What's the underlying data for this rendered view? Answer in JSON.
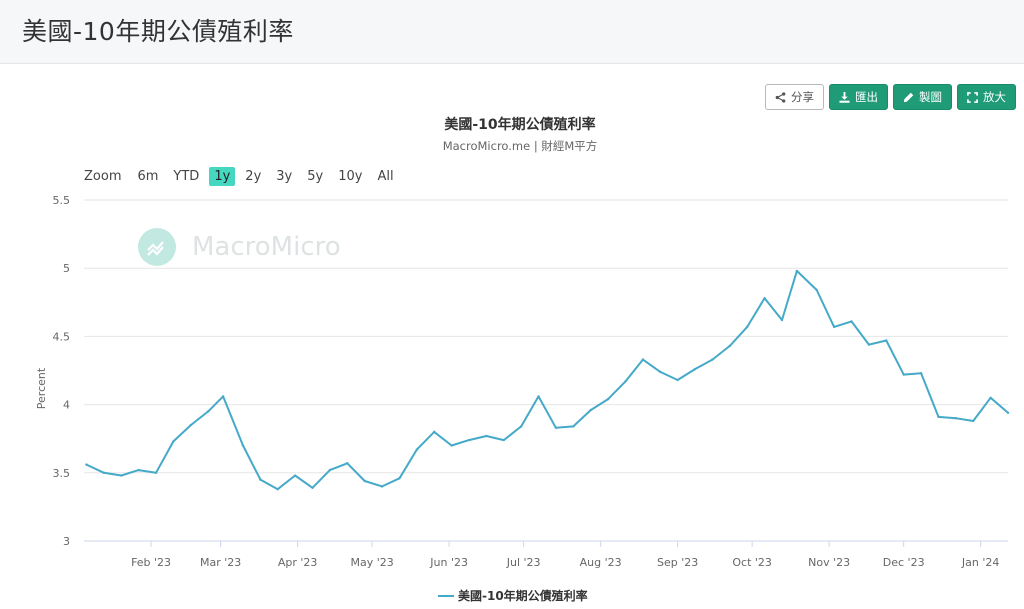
{
  "page": {
    "title": "美國-10年期公債殖利率"
  },
  "toolbar": {
    "share_label": "分享",
    "export_label": "匯出",
    "draw_label": "製圖",
    "fullscreen_label": "放大"
  },
  "range_selector": {
    "label": "Zoom",
    "buttons": [
      "6m",
      "YTD",
      "1y",
      "2y",
      "3y",
      "5y",
      "10y",
      "All"
    ],
    "active": "1y"
  },
  "watermark": {
    "text": "MacroMicro"
  },
  "colors": {
    "series": "#45a9c8",
    "accent": "#1f9b77",
    "range_active": "#45d7c0"
  },
  "chart_data": {
    "type": "line",
    "title": "美國-10年期公債殖利率",
    "subtitle": "MacroMicro.me | 財經M平方",
    "ylabel": "Percent",
    "xlabel": "",
    "ylim": [
      3,
      5.5
    ],
    "yticks": [
      "3",
      "3.5",
      "4",
      "4.5",
      "5",
      "5.5"
    ],
    "xticks": [
      {
        "label": "Feb '23",
        "date": "2023-02-01"
      },
      {
        "label": "Mar '23",
        "date": "2023-03-01"
      },
      {
        "label": "Apr '23",
        "date": "2023-04-01"
      },
      {
        "label": "May '23",
        "date": "2023-05-01"
      },
      {
        "label": "Jun '23",
        "date": "2023-06-01"
      },
      {
        "label": "Jul '23",
        "date": "2023-07-01"
      },
      {
        "label": "Aug '23",
        "date": "2023-08-01"
      },
      {
        "label": "Sep '23",
        "date": "2023-09-01"
      },
      {
        "label": "Oct '23",
        "date": "2023-10-01"
      },
      {
        "label": "Nov '23",
        "date": "2023-11-01"
      },
      {
        "label": "Dec '23",
        "date": "2023-12-01"
      },
      {
        "label": "Jan '24",
        "date": "2024-01-01"
      }
    ],
    "grid": true,
    "legend": "bottom-center",
    "series": [
      {
        "name": "美國-10年期公債殖利率",
        "color": "#45a9c8",
        "x": [
          "2023-01-06",
          "2023-01-13",
          "2023-01-20",
          "2023-01-27",
          "2023-02-03",
          "2023-02-10",
          "2023-02-17",
          "2023-02-24",
          "2023-03-02",
          "2023-03-10",
          "2023-03-17",
          "2023-03-24",
          "2023-03-31",
          "2023-04-07",
          "2023-04-14",
          "2023-04-21",
          "2023-04-28",
          "2023-05-05",
          "2023-05-12",
          "2023-05-19",
          "2023-05-26",
          "2023-06-02",
          "2023-06-09",
          "2023-06-16",
          "2023-06-23",
          "2023-06-30",
          "2023-07-07",
          "2023-07-14",
          "2023-07-21",
          "2023-07-28",
          "2023-08-04",
          "2023-08-11",
          "2023-08-18",
          "2023-08-25",
          "2023-09-01",
          "2023-09-08",
          "2023-09-15",
          "2023-09-22",
          "2023-09-29",
          "2023-10-06",
          "2023-10-13",
          "2023-10-19",
          "2023-10-27",
          "2023-11-03",
          "2023-11-10",
          "2023-11-17",
          "2023-11-24",
          "2023-12-01",
          "2023-12-08",
          "2023-12-15",
          "2023-12-22",
          "2023-12-29",
          "2024-01-05",
          "2024-01-12"
        ],
        "values": [
          3.56,
          3.5,
          3.48,
          3.52,
          3.5,
          3.73,
          3.85,
          3.95,
          4.06,
          3.7,
          3.45,
          3.38,
          3.48,
          3.39,
          3.52,
          3.57,
          3.44,
          3.4,
          3.46,
          3.67,
          3.8,
          3.7,
          3.74,
          3.77,
          3.74,
          3.84,
          4.06,
          3.83,
          3.84,
          3.96,
          4.04,
          4.17,
          4.33,
          4.24,
          4.18,
          4.26,
          4.33,
          4.43,
          4.57,
          4.78,
          4.62,
          4.98,
          4.84,
          4.57,
          4.61,
          4.44,
          4.47,
          4.22,
          4.23,
          3.91,
          3.9,
          3.88,
          4.05,
          3.94
        ]
      }
    ]
  }
}
